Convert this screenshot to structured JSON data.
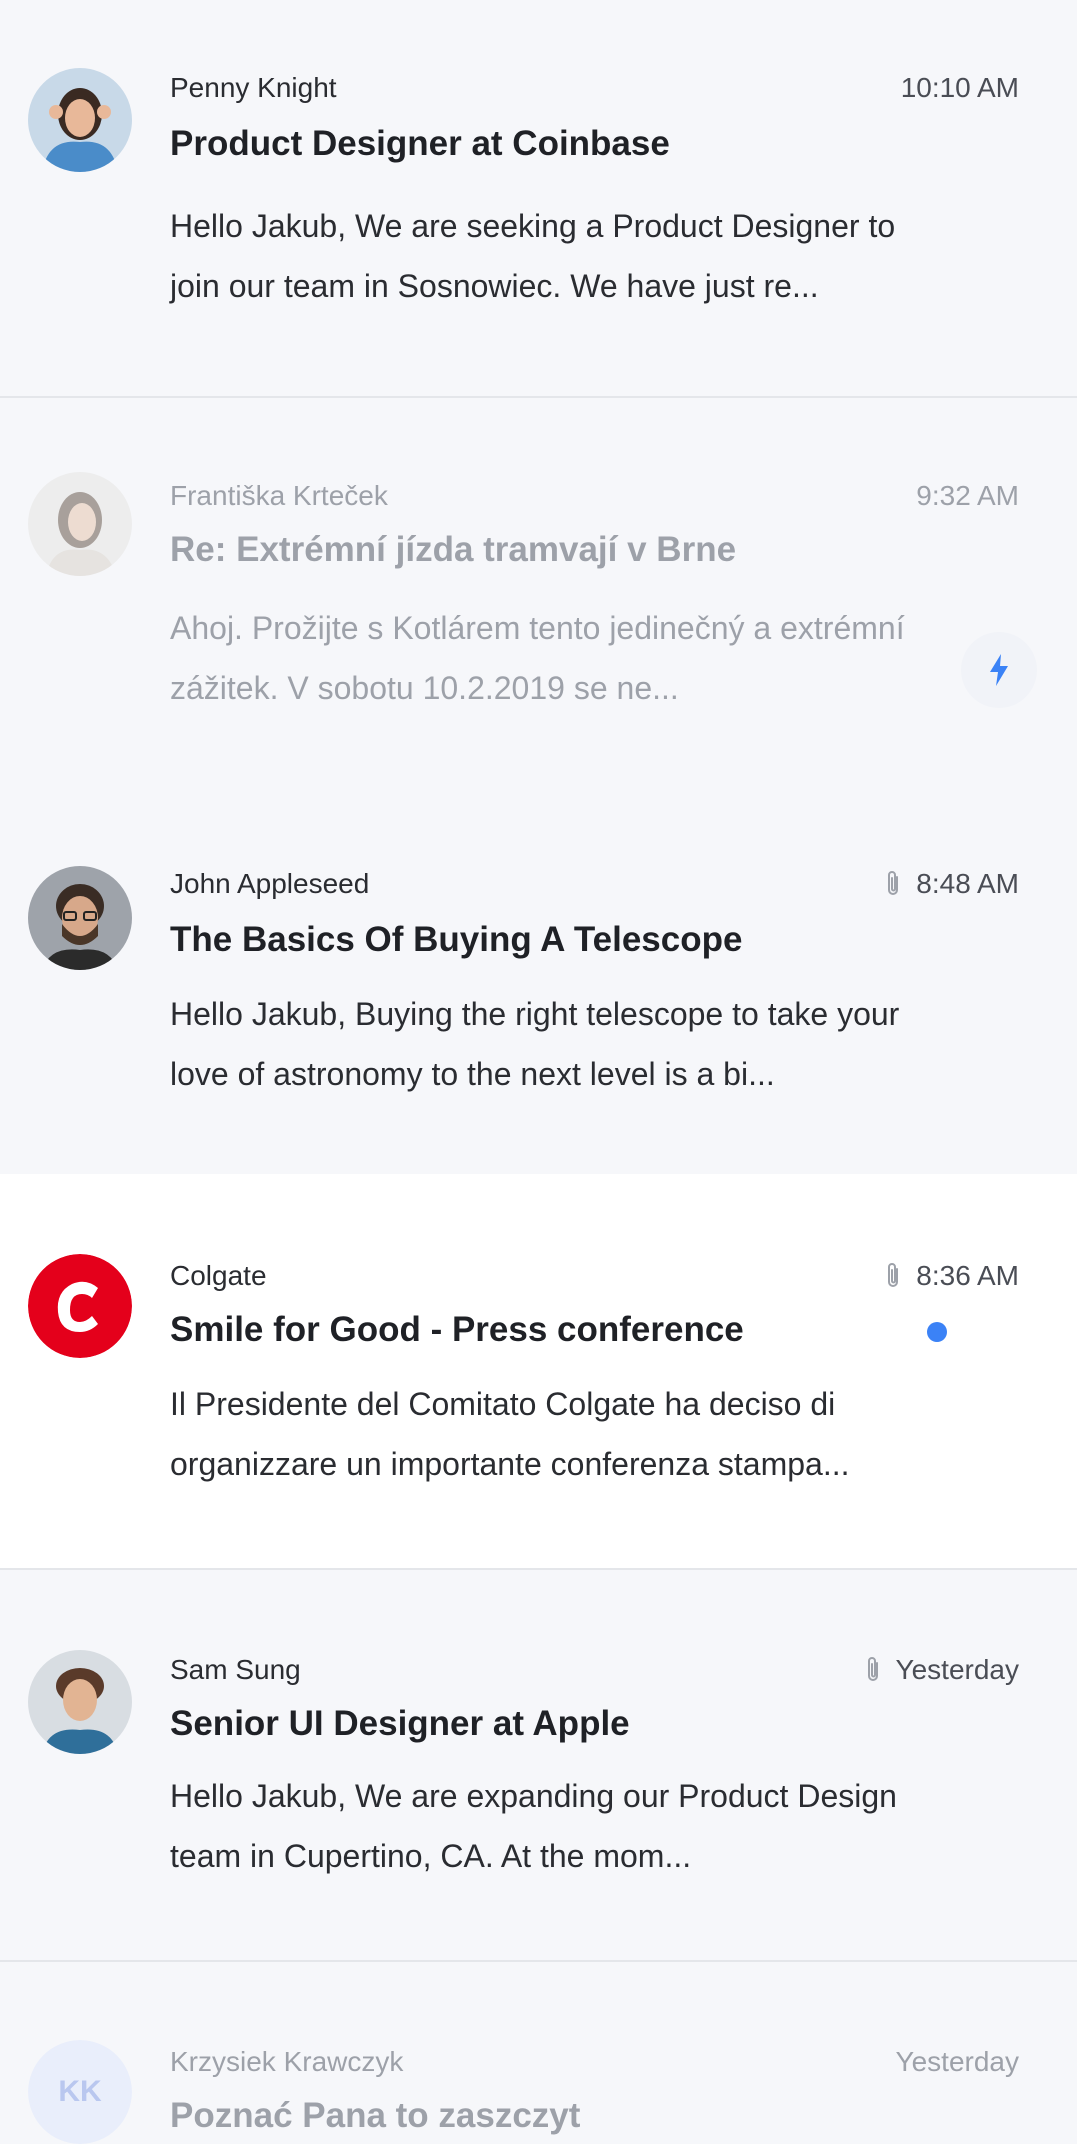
{
  "messages": [
    {
      "sender": "Penny Knight",
      "time": "10:10 AM",
      "subject": "Product Designer at Coinbase",
      "preview": "Hello Jakub, We are seeking a Product Designer to join our team in Sosnowiec. We have just re..."
    },
    {
      "sender": "Františka Krteček",
      "time": "9:32 AM",
      "subject": "Re: Extrémní jízda tramvají v Brne",
      "preview": "Ahoj. Prožijte s Kotlárem tento jedinečný a extrémní zážitek. V sobotu 10.2.2019 se ne...",
      "action_icon": "lightning-icon"
    },
    {
      "sender": "John Appleseed",
      "time": "8:48 AM",
      "subject": "The Basics Of Buying A Telescope",
      "preview": "Hello Jakub, Buying the right telescope to take your love of astronomy to the next level is a bi...",
      "attachment": true
    },
    {
      "sender": "Colgate",
      "time": "8:36 AM",
      "subject": "Smile for Good - Press conference",
      "preview": "Il Presidente del Comitato Colgate ha deciso di organizzare un importante conferenza stampa...",
      "attachment": true,
      "unread": true
    },
    {
      "sender": "Sam Sung",
      "time": "Yesterday",
      "subject": "Senior UI Designer at Apple",
      "preview": "Hello Jakub, We are expanding our Product Design team in Cupertino, CA. At the mom...",
      "attachment": true
    },
    {
      "sender": "Krzysiek Krawczyk",
      "time": "Yesterday",
      "subject": "Poznać Pana to zaszczyt",
      "initials": "KK"
    }
  ],
  "colors": {
    "background": "#f6f7fa",
    "selected_background": "#ffffff",
    "unread_dot": "#3b82f6",
    "accent": "#3b82f6",
    "colgate_red": "#e4001b"
  }
}
